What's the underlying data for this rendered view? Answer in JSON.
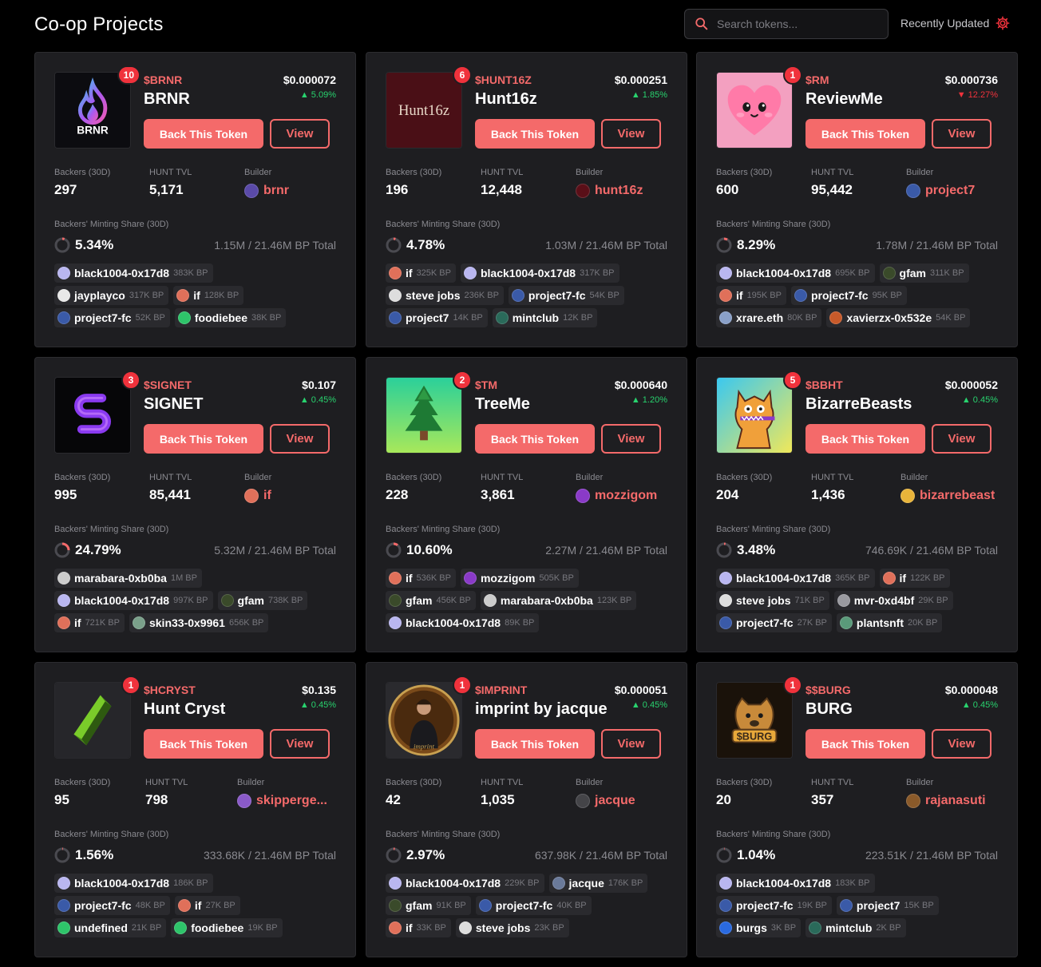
{
  "header": {
    "title": "Co-op Projects",
    "search_placeholder": "Search tokens...",
    "sort_label": "Recently Updated"
  },
  "labels": {
    "back_button": "Back This Token",
    "view_button": "View",
    "backers": "Backers (30D)",
    "tvl": "HUNT TVL",
    "builder": "Builder",
    "minting_share": "Backers' Minting Share (30D)"
  },
  "colors": {
    "accent": "#f46a6a",
    "badge": "#f0323c",
    "positive": "#28d26e",
    "negative": "#f0323c",
    "card_bg": "#1e1e21"
  },
  "cards": [
    {
      "badge": "10",
      "ticker": "$BRNR",
      "name": "BRNR",
      "price": "$0.000072",
      "change": "▲ 5.09%",
      "direction": "up",
      "logo": "flame-logo",
      "backers": "297",
      "tvl": "5,171",
      "builder": "brnr",
      "builder_color": "#5a4aa8",
      "share": "5.34%",
      "share_value": 5.34,
      "total": "1.15M / 21.46M BP Total",
      "chips": [
        [
          {
            "name": "black1004-0x17d8",
            "bp": "383K BP",
            "color": "#b9b6f0"
          }
        ],
        [
          {
            "name": "jayplayco",
            "bp": "317K BP",
            "color": "#e8e8e8"
          },
          {
            "name": "if",
            "bp": "128K BP",
            "color": "#e0705a"
          }
        ],
        [
          {
            "name": "project7-fc",
            "bp": "52K BP",
            "color": "#3a5aa8"
          },
          {
            "name": "foodiebee",
            "bp": "38K BP",
            "color": "#2ec46a"
          }
        ]
      ]
    },
    {
      "badge": "6",
      "ticker": "$HUNT16Z",
      "name": "Hunt16z",
      "price": "$0.000251",
      "change": "▲ 1.85%",
      "direction": "up",
      "logo": "hunt16z-logo",
      "logo_text": "Hunt16z",
      "backers": "196",
      "tvl": "12,448",
      "builder": "hunt16z",
      "builder_color": "#5a0f18",
      "share": "4.78%",
      "share_value": 4.78,
      "total": "1.03M / 21.46M BP Total",
      "chips": [
        [
          {
            "name": "if",
            "bp": "325K BP",
            "color": "#e0705a"
          },
          {
            "name": "black1004-0x17d8",
            "bp": "317K BP",
            "color": "#b9b6f0"
          }
        ],
        [
          {
            "name": "steve jobs",
            "bp": "236K BP",
            "color": "#dddddd"
          },
          {
            "name": "project7-fc",
            "bp": "54K BP",
            "color": "#3a5aa8"
          }
        ],
        [
          {
            "name": "project7",
            "bp": "14K BP",
            "color": "#3a5aa8"
          },
          {
            "name": "mintclub",
            "bp": "12K BP",
            "color": "#2a6a5a"
          }
        ]
      ]
    },
    {
      "badge": "1",
      "ticker": "$RM",
      "name": "ReviewMe",
      "price": "$0.000736",
      "change": "▼ 12.27%",
      "direction": "down",
      "logo": "heart-logo",
      "backers": "600",
      "tvl": "95,442",
      "builder": "project7",
      "builder_color": "#3a5aa8",
      "share": "8.29%",
      "share_value": 8.29,
      "total": "1.78M / 21.46M BP Total",
      "chips": [
        [
          {
            "name": "black1004-0x17d8",
            "bp": "695K BP",
            "color": "#b9b6f0"
          },
          {
            "name": "gfam",
            "bp": "311K BP",
            "color": "#3a4a2a"
          }
        ],
        [
          {
            "name": "if",
            "bp": "195K BP",
            "color": "#e0705a"
          },
          {
            "name": "project7-fc",
            "bp": "95K BP",
            "color": "#3a5aa8"
          }
        ],
        [
          {
            "name": "xrare.eth",
            "bp": "80K BP",
            "color": "#8aa0c8"
          },
          {
            "name": "xavierzx-0x532e",
            "bp": "54K BP",
            "color": "#c85a2a"
          }
        ]
      ]
    },
    {
      "badge": "3",
      "ticker": "$SIGNET",
      "name": "SIGNET",
      "price": "$0.107",
      "change": "▲ 0.45%",
      "direction": "up",
      "logo": "signet-logo",
      "backers": "995",
      "tvl": "85,441",
      "builder": "if",
      "builder_color": "#e0705a",
      "share": "24.79%",
      "share_value": 24.79,
      "total": "5.32M / 21.46M BP Total",
      "chips": [
        [
          {
            "name": "marabara-0xb0ba",
            "bp": "1M BP",
            "color": "#cccccc"
          }
        ],
        [
          {
            "name": "black1004-0x17d8",
            "bp": "997K BP",
            "color": "#b9b6f0"
          },
          {
            "name": "gfam",
            "bp": "738K BP",
            "color": "#3a4a2a"
          }
        ],
        [
          {
            "name": "if",
            "bp": "721K BP",
            "color": "#e0705a"
          },
          {
            "name": "skin33-0x9961",
            "bp": "656K BP",
            "color": "#7aa08a"
          }
        ]
      ]
    },
    {
      "badge": "2",
      "ticker": "$TM",
      "name": "TreeMe",
      "price": "$0.000640",
      "change": "▲ 1.20%",
      "direction": "up",
      "logo": "tree-logo",
      "backers": "228",
      "tvl": "3,861",
      "builder": "mozzigom",
      "builder_color": "#8a3ac8",
      "share": "10.60%",
      "share_value": 10.6,
      "total": "2.27M / 21.46M BP Total",
      "chips": [
        [
          {
            "name": "if",
            "bp": "536K BP",
            "color": "#e0705a"
          },
          {
            "name": "mozzigom",
            "bp": "505K BP",
            "color": "#8a3ac8"
          }
        ],
        [
          {
            "name": "gfam",
            "bp": "456K BP",
            "color": "#3a4a2a"
          },
          {
            "name": "marabara-0xb0ba",
            "bp": "123K BP",
            "color": "#cccccc"
          }
        ],
        [
          {
            "name": "black1004-0x17d8",
            "bp": "89K BP",
            "color": "#b9b6f0"
          }
        ]
      ]
    },
    {
      "badge": "5",
      "ticker": "$BBHT",
      "name": "BizarreBeasts",
      "price": "$0.000052",
      "change": "▲ 0.45%",
      "direction": "up",
      "logo": "beast-logo",
      "backers": "204",
      "tvl": "1,436",
      "builder": "bizarrebeast",
      "builder_color": "#e8b43a",
      "share": "3.48%",
      "share_value": 3.48,
      "total": "746.69K / 21.46M BP Total",
      "chips": [
        [
          {
            "name": "black1004-0x17d8",
            "bp": "365K BP",
            "color": "#b9b6f0"
          },
          {
            "name": "if",
            "bp": "122K BP",
            "color": "#e0705a"
          }
        ],
        [
          {
            "name": "steve jobs",
            "bp": "71K BP",
            "color": "#dddddd"
          },
          {
            "name": "mvr-0xd4bf",
            "bp": "29K BP",
            "color": "#9a9aa0"
          }
        ],
        [
          {
            "name": "project7-fc",
            "bp": "27K BP",
            "color": "#3a5aa8"
          },
          {
            "name": "plantsnft",
            "bp": "20K BP",
            "color": "#5a9a7a"
          }
        ]
      ]
    },
    {
      "badge": "1",
      "ticker": "$HCRYST",
      "name": "Hunt Cryst",
      "price": "$0.135",
      "change": "▲ 0.45%",
      "direction": "up",
      "logo": "crystal-logo",
      "backers": "95",
      "tvl": "798",
      "builder": "skipperge...",
      "builder_color": "#8a5ac8",
      "share": "1.56%",
      "share_value": 1.56,
      "total": "333.68K / 21.46M BP Total",
      "chips": [
        [
          {
            "name": "black1004-0x17d8",
            "bp": "186K BP",
            "color": "#b9b6f0"
          }
        ],
        [
          {
            "name": "project7-fc",
            "bp": "48K BP",
            "color": "#3a5aa8"
          },
          {
            "name": "if",
            "bp": "27K BP",
            "color": "#e0705a"
          }
        ],
        [
          {
            "name": "undefined",
            "bp": "21K BP",
            "color": "#2ec46a"
          },
          {
            "name": "foodiebee",
            "bp": "19K BP",
            "color": "#2ec46a"
          }
        ]
      ]
    },
    {
      "badge": "1",
      "ticker": "$IMPRINT",
      "name": "imprint by jacque",
      "price": "$0.000051",
      "change": "▲ 0.45%",
      "direction": "up",
      "logo": "imprint-logo",
      "logo_text": "imprint",
      "backers": "42",
      "tvl": "1,035",
      "builder": "jacque",
      "builder_color": "#444448",
      "share": "2.97%",
      "share_value": 2.97,
      "total": "637.98K / 21.46M BP Total",
      "chips": [
        [
          {
            "name": "black1004-0x17d8",
            "bp": "229K BP",
            "color": "#b9b6f0"
          },
          {
            "name": "jacque",
            "bp": "176K BP",
            "color": "#6a7a9a"
          }
        ],
        [
          {
            "name": "gfam",
            "bp": "91K BP",
            "color": "#3a4a2a"
          },
          {
            "name": "project7-fc",
            "bp": "40K BP",
            "color": "#3a5aa8"
          }
        ],
        [
          {
            "name": "if",
            "bp": "33K BP",
            "color": "#e0705a"
          },
          {
            "name": "steve jobs",
            "bp": "23K BP",
            "color": "#dddddd"
          }
        ]
      ]
    },
    {
      "badge": "1",
      "ticker": "$$BURG",
      "name": "BURG",
      "price": "$0.000048",
      "change": "▲ 0.45%",
      "direction": "up",
      "logo": "burg-logo",
      "logo_text": "$BURG",
      "backers": "20",
      "tvl": "357",
      "builder": "rajanasuti",
      "builder_color": "#8a5a2a",
      "share": "1.04%",
      "share_value": 1.04,
      "total": "223.51K / 21.46M BP Total",
      "chips": [
        [
          {
            "name": "black1004-0x17d8",
            "bp": "183K BP",
            "color": "#b9b6f0"
          }
        ],
        [
          {
            "name": "project7-fc",
            "bp": "19K BP",
            "color": "#3a5aa8"
          },
          {
            "name": "project7",
            "bp": "15K BP",
            "color": "#3a5aa8"
          }
        ],
        [
          {
            "name": "burgs",
            "bp": "3K BP",
            "color": "#2a6ae0"
          },
          {
            "name": "mintclub",
            "bp": "2K BP",
            "color": "#2a6a5a"
          }
        ]
      ]
    }
  ]
}
